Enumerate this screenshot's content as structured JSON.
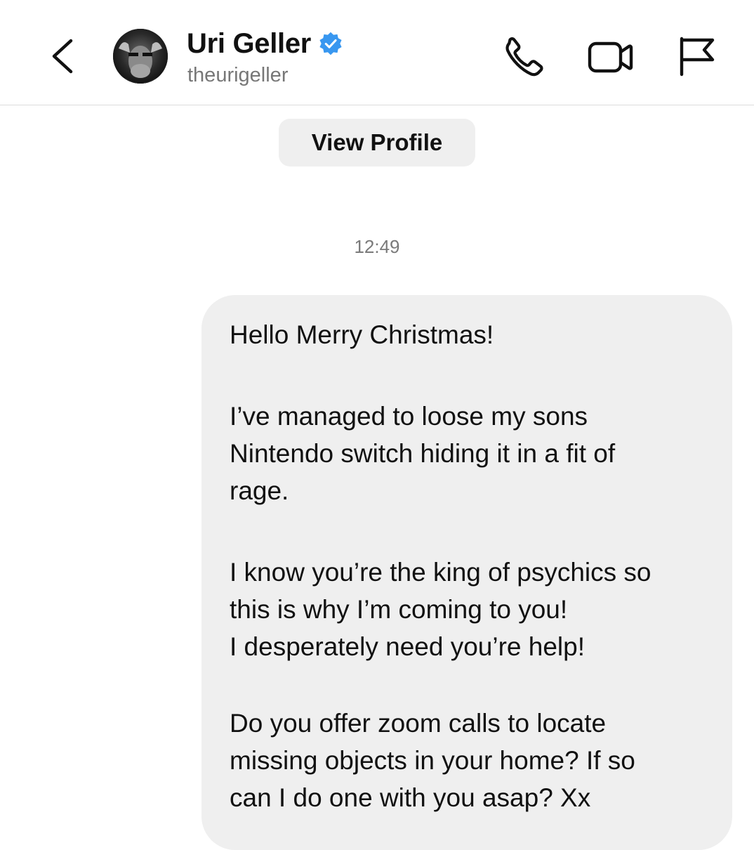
{
  "header": {
    "display_name": "Uri Geller",
    "username": "theurigeller",
    "verified": true,
    "icons": {
      "back": "chevron-left-icon",
      "call": "phone-icon",
      "video": "video-camera-icon",
      "report": "flag-icon",
      "verified": "verified-badge-icon"
    },
    "colors": {
      "verified_badge": "#3897f0"
    }
  },
  "view_profile": {
    "label": "View Profile"
  },
  "conversation": {
    "timestamp": "12:49",
    "messages": [
      {
        "paragraphs": [
          "Hello Merry Christmas!",
          "I’ve managed to loose my sons\nNintendo switch hiding it in a fit of\nrage.",
          "I know you’re the king of psychics so\nthis is why I’m coming to you!\nI desperately need you’re help!",
          "Do you offer zoom calls to locate\nmissing objects in your home? If so\ncan I do one with you asap? Xx"
        ]
      }
    ]
  }
}
